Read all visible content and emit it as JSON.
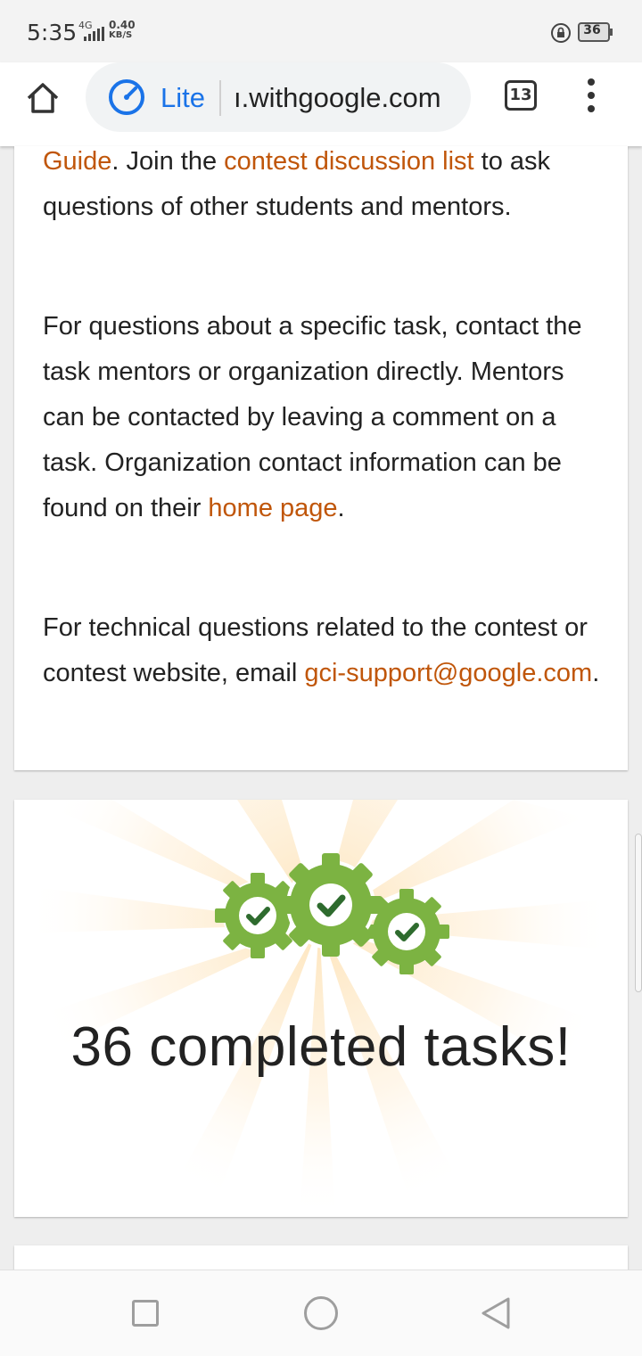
{
  "status_bar": {
    "time": "5:35",
    "network": "4G",
    "speed_value": "0.40",
    "speed_unit": "KB/S",
    "battery_level": "36"
  },
  "toolbar": {
    "lite_label": "Lite",
    "url": "ı.withgoogle.com",
    "tab_count": "13"
  },
  "card1": {
    "p1": {
      "link1": "Guide",
      "text1": ". Join the ",
      "link2": "contest discussion list",
      "text2": " to ask questions of other students and mentors."
    },
    "p2": {
      "text1": "For questions about a specific task, contact the task mentors or organization directly. Mentors can be contacted by leaving a comment on a task. Organization contact information can be found on their ",
      "link": "home page",
      "text2": "."
    },
    "p3": {
      "text1": "For technical questions related to the contest or contest website, email ",
      "link": "gci-support@google.com",
      "text2": "."
    }
  },
  "card2": {
    "completed_text": "36 completed tasks!"
  },
  "colors": {
    "link": "#c0560a",
    "lite_blue": "#1a73e8",
    "gear_green": "#7cb342",
    "check_green": "#2e6b2e"
  }
}
